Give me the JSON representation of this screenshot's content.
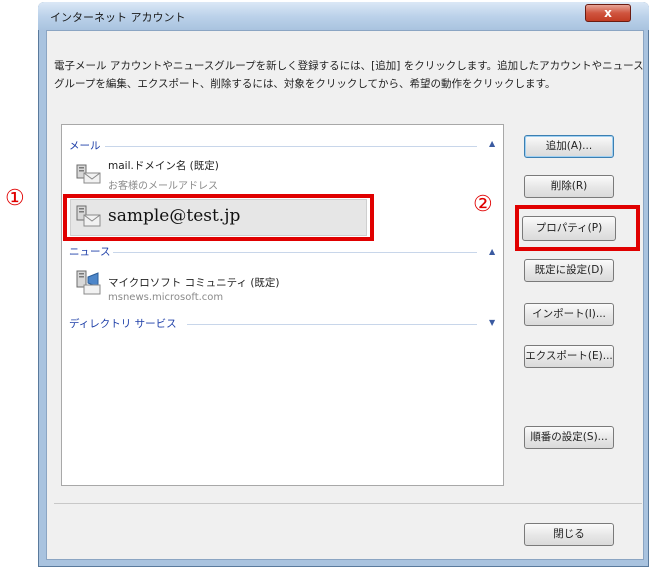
{
  "window": {
    "title": "インターネット アカウント",
    "close_label": "x"
  },
  "description": "電子メール アカウントやニュースグループを新しく登録するには、[追加] をクリックします。追加したアカウントやニュースグループを編集、エクスポート、削除するには、対象をクリックしてから、希望の動作をクリックします。",
  "account_list": {
    "mail_group": {
      "label": "メール",
      "accounts": [
        {
          "name": "mail.ドメイン名 (既定)",
          "sub": "お客様のメールアドレス"
        },
        {
          "name": "sample@test.jp"
        }
      ]
    },
    "news_group": {
      "label": "ニュース",
      "accounts": [
        {
          "name": "マイクロソフト コミュニティ (既定)",
          "sub": "msnews.microsoft.com"
        }
      ]
    },
    "directory_group": {
      "label": "ディレクトリ サービス"
    }
  },
  "buttons": {
    "add": "追加(A)...",
    "remove": "削除(R)",
    "properties": "プロパティ(P)",
    "set_default": "既定に設定(D)",
    "import": "インポート(I)...",
    "export": "エクスポート(E)...",
    "order": "順番の設定(S)...",
    "close": "閉じる"
  },
  "annotations": {
    "marker1": "①",
    "marker2": "②"
  },
  "colors": {
    "annotation_red": "#e00000",
    "group_header_blue": "#1e3fa8"
  },
  "icons": {
    "account": "mail-account-icon",
    "news": "news-account-icon",
    "caret_up": "chevron-up-icon",
    "caret_down": "chevron-down-icon"
  }
}
